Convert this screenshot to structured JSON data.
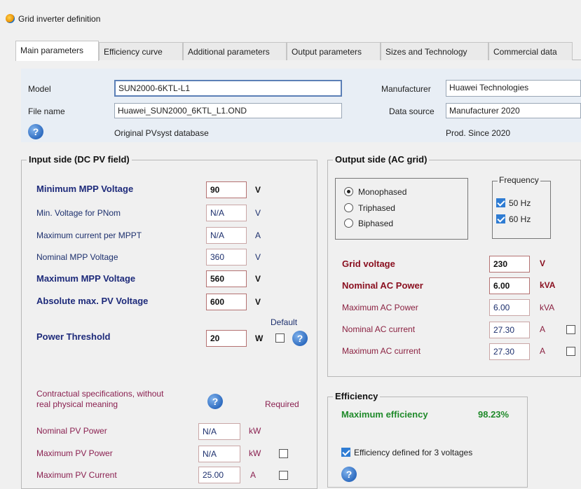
{
  "window": {
    "title": "Grid inverter definition"
  },
  "tabs": [
    {
      "label": "Main parameters"
    },
    {
      "label": "Efficiency curve"
    },
    {
      "label": "Additional parameters"
    },
    {
      "label": "Output parameters"
    },
    {
      "label": "Sizes and Technology"
    },
    {
      "label": "Commercial data"
    }
  ],
  "header": {
    "model_label": "Model",
    "model_value": "SUN2000-6KTL-L1",
    "filename_label": "File name",
    "filename_value": "Huawei_SUN2000_6KTL_L1.OND",
    "manufacturer_label": "Manufacturer",
    "manufacturer_value": "Huawei Technologies",
    "datasource_label": "Data source",
    "datasource_value": "Manufacturer 2020",
    "origin_text": "Original PVsyst database",
    "prod_since": "Prod. Since 2020"
  },
  "input_side": {
    "title": "Input side (DC PV field)",
    "min_mpp_label": "Minimum MPP Voltage",
    "min_mpp_value": "90",
    "min_mpp_unit": "V",
    "min_v_pnom_label": "Min. Voltage for PNom",
    "min_v_pnom_value": "N/A",
    "min_v_pnom_unit": "V",
    "max_current_label": "Maximum current per MPPT",
    "max_current_value": "N/A",
    "max_current_unit": "A",
    "nom_mpp_label": "Nominal MPP Voltage",
    "nom_mpp_value": "360",
    "nom_mpp_unit": "V",
    "max_mpp_label": "Maximum MPP Voltage",
    "max_mpp_value": "560",
    "max_mpp_unit": "V",
    "abs_max_label": "Absolute max. PV Voltage",
    "abs_max_value": "600",
    "abs_max_unit": "V",
    "default_label": "Default",
    "threshold_label": "Power Threshold",
    "threshold_value": "20",
    "threshold_unit": "W",
    "contract_text_1": "Contractual specifications, without",
    "contract_text_2": "real physical meaning",
    "required_label": "Required",
    "nom_pv_label": "Nominal PV Power",
    "nom_pv_value": "N/A",
    "nom_pv_unit": "kW",
    "max_pv_label": "Maximum PV Power",
    "max_pv_value": "N/A",
    "max_pv_unit": "kW",
    "max_pv_current_label": "Maximum PV Current",
    "max_pv_current_value": "25.00",
    "max_pv_current_unit": "A"
  },
  "output_side": {
    "title": "Output side (AC grid)",
    "phase_options": [
      "Monophased",
      "Triphased",
      "Biphased"
    ],
    "phase_selected": "Monophased",
    "frequency_title": "Frequency",
    "freq_50": "50 Hz",
    "freq_60": "60 Hz",
    "grid_voltage_label": "Grid voltage",
    "grid_voltage_value": "230",
    "grid_voltage_unit": "V",
    "nom_ac_label": "Nominal AC Power",
    "nom_ac_value": "6.00",
    "nom_ac_unit": "kVA",
    "max_ac_label": "Maximum AC Power",
    "max_ac_value": "6.00",
    "max_ac_unit": "kVA",
    "nom_ac_current_label": "Nominal AC current",
    "nom_ac_current_value": "27.30",
    "nom_ac_current_unit": "A",
    "max_ac_current_label": "Maximum AC current",
    "max_ac_current_value": "27.30",
    "max_ac_current_unit": "A"
  },
  "efficiency": {
    "title": "Efficiency",
    "max_eff_label": "Maximum efficiency",
    "max_eff_value": "98.23%",
    "three_voltages_label": "Efficiency defined for 3 voltages"
  },
  "colors": {
    "header_panel": "#e8eef5",
    "accent_blue": "#2f7cd3",
    "dc_label": "#1d2a7a",
    "ac_label": "#8a1020",
    "eff_green": "#1f8a2a"
  }
}
